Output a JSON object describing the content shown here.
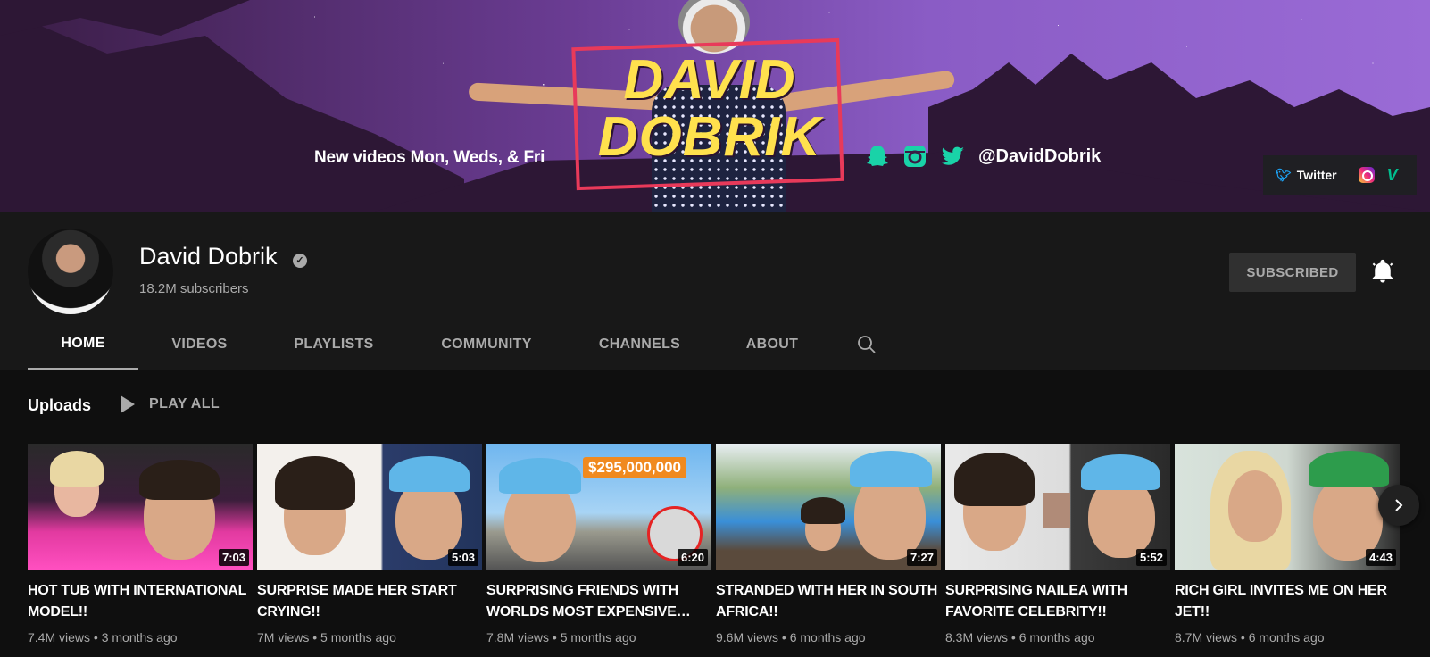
{
  "banner": {
    "tagline": "New videos Mon, Weds, & Fri",
    "logo_line1": "DAVID",
    "logo_line2": "DOBRIK",
    "handle": "@DavidDobrik",
    "links": {
      "twitter_label": "Twitter"
    }
  },
  "channel": {
    "name": "David Dobrik",
    "subscribers": "18.2M subscribers",
    "subscribe_button": "SUBSCRIBED"
  },
  "tabs": [
    {
      "label": "HOME",
      "active": true
    },
    {
      "label": "VIDEOS"
    },
    {
      "label": "PLAYLISTS"
    },
    {
      "label": "COMMUNITY"
    },
    {
      "label": "CHANNELS"
    },
    {
      "label": "ABOUT"
    }
  ],
  "shelf": {
    "title": "Uploads",
    "play_all": "PLAY ALL"
  },
  "videos": [
    {
      "title": "HOT TUB WITH INTERNATIONAL MODEL!!",
      "duration": "7:03",
      "meta": "7.4M views • 3 months ago"
    },
    {
      "title": "SURPRISE MADE HER START CRYING!!",
      "duration": "5:03",
      "meta": "7M views • 5 months ago"
    },
    {
      "title": "SURPRISING FRIENDS WITH WORLDS MOST EXPENSIVE…",
      "duration": "6:20",
      "meta": "7.8M views • 5 months ago",
      "thumb_text": "$295,000,000"
    },
    {
      "title": "STRANDED WITH HER IN SOUTH AFRICA!!",
      "duration": "7:27",
      "meta": "9.6M views • 6 months ago"
    },
    {
      "title": "SURPRISING NAILEA WITH FAVORITE CELEBRITY!!",
      "duration": "5:52",
      "meta": "8.3M views • 6 months ago"
    },
    {
      "title": "RICH GIRL INVITES ME ON HER JET!!",
      "duration": "4:43",
      "meta": "8.7M views • 6 months ago"
    }
  ],
  "colors": {
    "background": "#181818",
    "content_background": "#0f0f0f",
    "muted_text": "#aaaaaa",
    "banner_accent": "#19d3a8",
    "logo_yellow": "#ffe14d",
    "logo_red": "#e83a5a"
  },
  "icons": {
    "verified": "verified-check-icon",
    "bell": "bell-icon",
    "search": "search-icon",
    "play": "play-icon",
    "next": "chevron-right-icon"
  }
}
